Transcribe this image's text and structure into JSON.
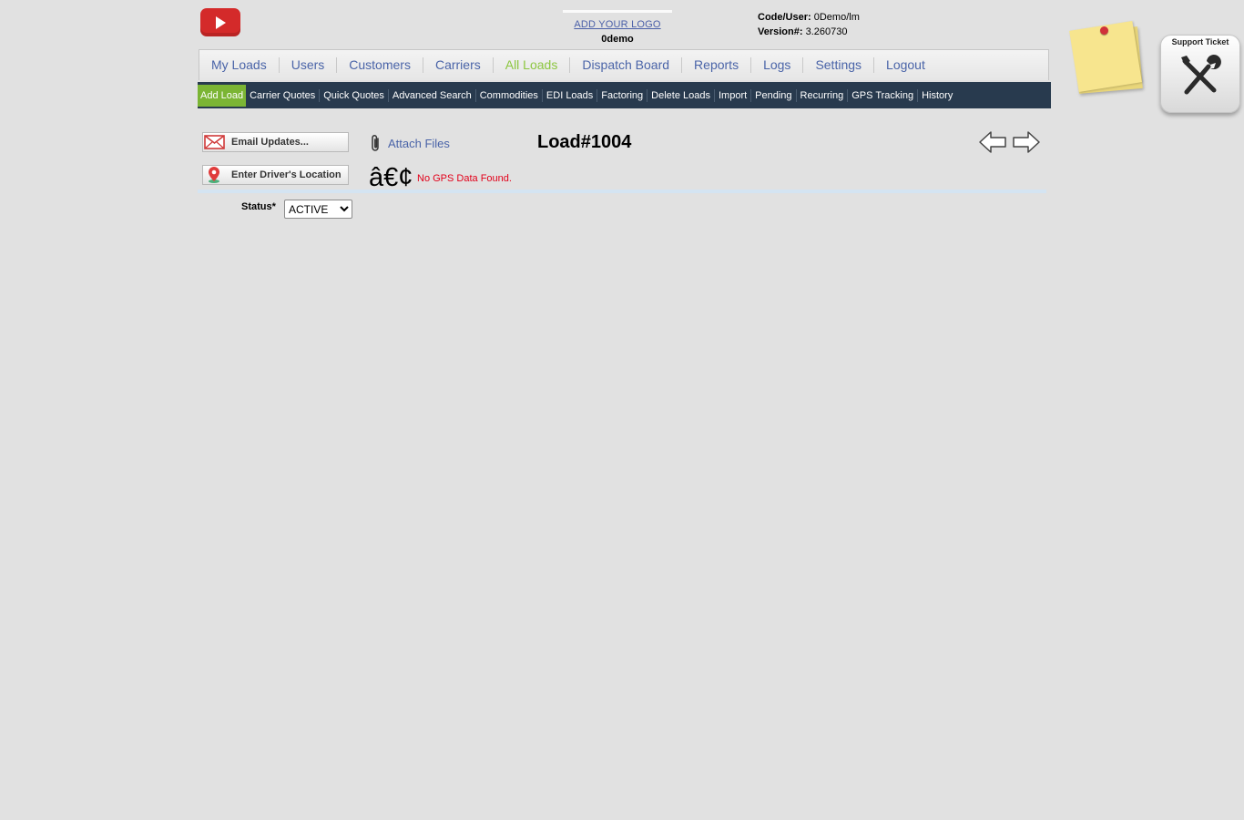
{
  "header": {
    "add_logo_link": "ADD YOUR LOGO",
    "company_name": "0demo",
    "code_user_label": "Code/User:",
    "code_user_value": " 0Demo/lm",
    "version_label": "Version#:",
    "version_value": " 3.260730",
    "support_ticket_label": "Support Ticket"
  },
  "main_nav": {
    "items": [
      "My Loads",
      "Users",
      "Customers",
      "Carriers",
      "All Loads",
      "Dispatch Board",
      "Reports",
      "Logs",
      "Settings",
      "Logout"
    ],
    "active": "All Loads"
  },
  "sub_nav": {
    "items": [
      "Add Load",
      "Carrier Quotes",
      "Quick Quotes",
      "Advanced Search",
      "Commodities",
      "EDI Loads",
      "Factoring",
      "Delete Loads",
      "Import",
      "Pending",
      "Recurring",
      "GPS Tracking",
      "History"
    ],
    "active": "Add Load"
  },
  "actions": {
    "email_updates": "Email Updates...",
    "enter_driver_location": "Enter Driver's Location",
    "attach_files": "Attach Files"
  },
  "load": {
    "title": "Load#1004"
  },
  "gps": {
    "bullet": "â€¢",
    "message": "No GPS Data Found."
  },
  "status": {
    "label": "Status*",
    "selected": "ACTIVE"
  },
  "icons": {
    "youtube": "youtube-icon",
    "sticky_note": "sticky-note-icon",
    "support": "wrench-screwdriver-icon",
    "email": "envelope-icon",
    "location": "map-pin-icon",
    "attach": "paperclip-icon",
    "prev": "arrow-left-icon",
    "next": "arrow-right-icon"
  },
  "colors": {
    "background": "#e1e1e1",
    "nav_link": "#4a64a8",
    "nav_active": "#8cc63f",
    "subnav_bg": "#283a4e",
    "subnav_active": "#7bb534",
    "error": "#e2001a",
    "youtube_red": "#d42a2a"
  }
}
